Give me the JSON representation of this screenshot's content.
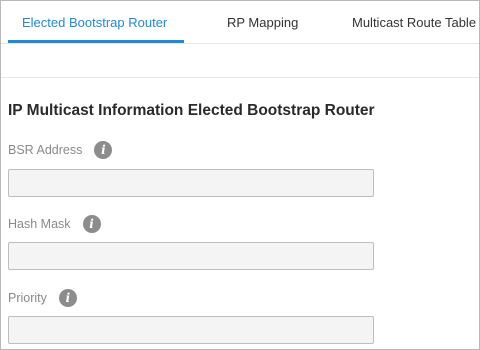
{
  "tabs": [
    {
      "label": "Elected Bootstrap Router",
      "active": true
    },
    {
      "label": "RP Mapping",
      "active": false
    },
    {
      "label": "Multicast Route Table",
      "active": false
    }
  ],
  "section": {
    "title": "IP Multicast Information Elected Bootstrap Router"
  },
  "fields": [
    {
      "label": "BSR Address",
      "value": "",
      "info_icon": "info-icon"
    },
    {
      "label": "Hash Mask",
      "value": "",
      "info_icon": "info-icon"
    },
    {
      "label": "Priority",
      "value": "",
      "info_icon": "info-icon"
    }
  ],
  "colors": {
    "accent": "#1f8ad6",
    "label": "#8a8a8a",
    "input_bg": "#f4f4f4",
    "info_icon": "#8c8c8c"
  }
}
